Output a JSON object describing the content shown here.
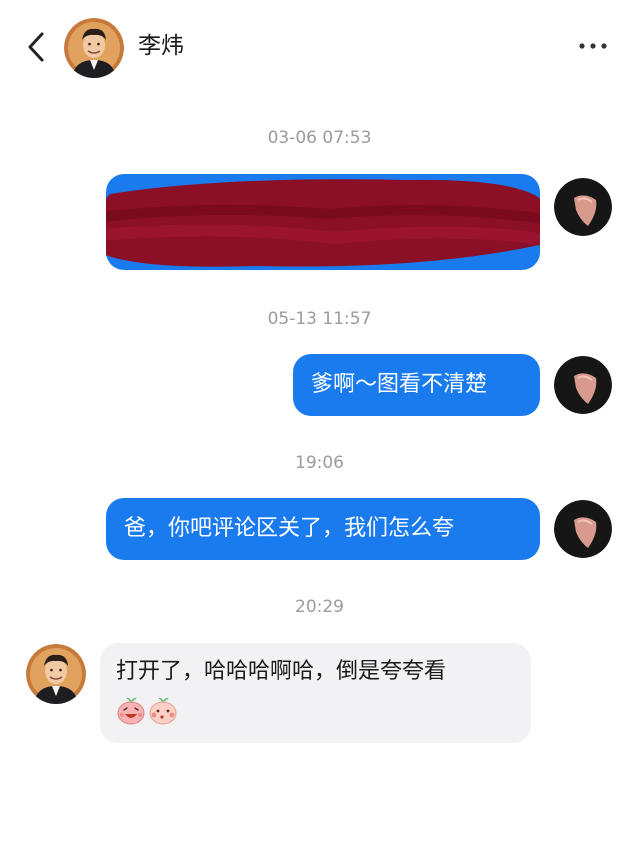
{
  "header": {
    "contact_name": "李炜",
    "back_icon": "chevron-left-icon",
    "more_icon": "more-dots-icon"
  },
  "messages": [
    {
      "timestamp": "03-06 07:53",
      "direction": "out",
      "text": "",
      "redacted": true
    },
    {
      "timestamp": "05-13 11:57",
      "direction": "out",
      "text": "爹啊～图看不清楚"
    },
    {
      "timestamp": "19:06",
      "direction": "out",
      "text": "爸，你吧评论区关了，我们怎么夸"
    },
    {
      "timestamp": "20:29",
      "direction": "in",
      "text": "打开了，哈哈哈啊哈，倒是夸夸看",
      "stickers": [
        "laughing-peach-emoji",
        "blushing-peach-emoji"
      ]
    }
  ],
  "colors": {
    "outgoing_bubble": "#1a7bef",
    "incoming_bubble": "#f2f2f4",
    "redaction": "#8b0f25",
    "timestamp": "#9b9b9b"
  }
}
